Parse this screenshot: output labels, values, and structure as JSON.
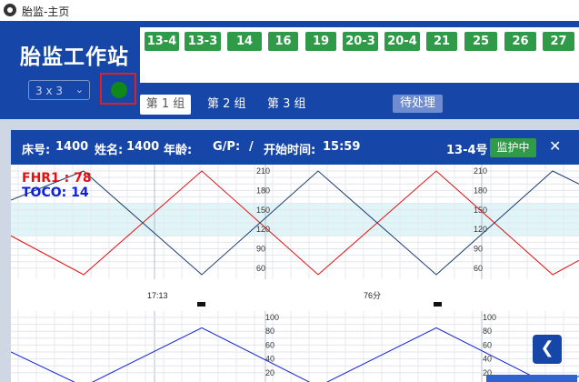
{
  "window": {
    "title": "胎监-主页"
  },
  "header": {
    "station_title": "胎监工作站",
    "beds": [
      "13-4",
      "13-3",
      "14",
      "16",
      "19",
      "20-3",
      "20-4",
      "21",
      "25",
      "26",
      "27"
    ],
    "layout_select": "3 x 3",
    "groups": [
      "第 1 组",
      "第 2 组",
      "第 3 组"
    ],
    "pending_label": "待处理",
    "colors": {
      "header_bg": "#1646a8",
      "bed_green": "#2f9a47",
      "status_green": "#0f8a1a",
      "highlight_red": "#e02020"
    }
  },
  "card": {
    "bed_no_label": "床号:",
    "bed_no": "1400",
    "name_label": "姓名:",
    "name": "1400",
    "age_label": "年龄:",
    "age": "",
    "gp_label": "G/P:",
    "gp": "/",
    "start_label": "开始时间:",
    "start_time": "15:59",
    "bed_tag": "13-4号",
    "monitor_status": "监护中",
    "close_icon": "close-icon"
  },
  "chart_data": [
    {
      "type": "line",
      "series": [
        {
          "name": "FHR1",
          "current": 78,
          "color": "#e41010"
        },
        {
          "name": "TOCO",
          "current": 14,
          "color": "#1020d8"
        }
      ],
      "legend": [
        "FHR1 : 78",
        "TOCO: 14"
      ],
      "y_ticks": [
        60,
        90,
        120,
        150,
        180,
        210
      ],
      "y_ticks_display": [
        "210",
        "180",
        "150",
        "120",
        "90",
        "60"
      ],
      "ylim": [
        50,
        210
      ],
      "normal_band": [
        110,
        160
      ],
      "time_labels": [
        "17:13",
        "76分"
      ]
    },
    {
      "type": "line",
      "series": [
        {
          "name": "TOCO",
          "color": "#1020d8"
        }
      ],
      "y_ticks_display": [
        "100",
        "80",
        "60",
        "40",
        "20"
      ],
      "ylim": [
        0,
        100
      ]
    }
  ]
}
